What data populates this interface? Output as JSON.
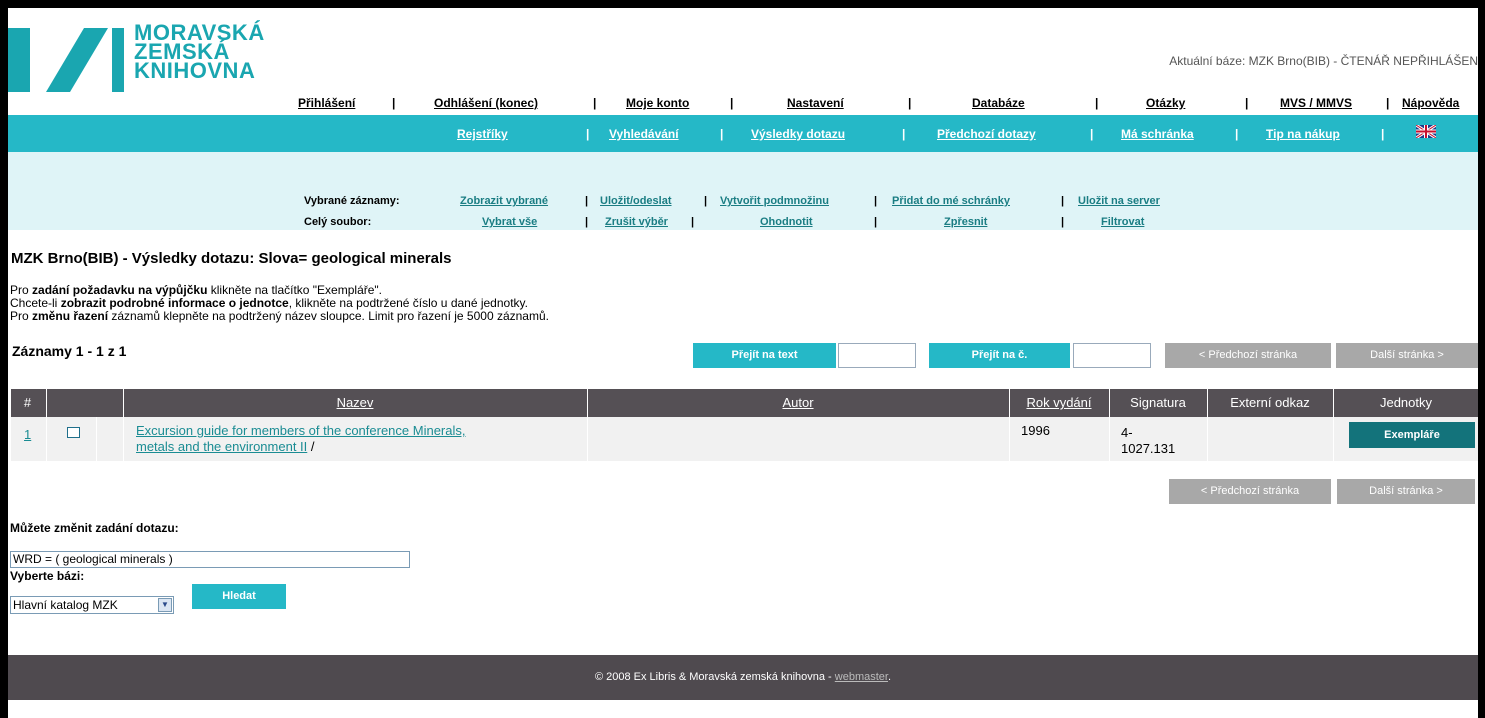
{
  "logo": {
    "lines": [
      "MORAVSKÁ",
      "ZEMSKÁ",
      "KNIHOVNA"
    ]
  },
  "header": {
    "current_base": "Aktuální báze: MZK Brno(BIB) - ČTENÁŘ NEPŘIHLÁŠEN"
  },
  "topnav": [
    "Přihlášení",
    "Odhlášení (konec)",
    "Moje konto",
    "Nastavení",
    "Databáze",
    "Otázky",
    "MVS / MMVS",
    "Nápověda"
  ],
  "mainnav": [
    "Rejstříky",
    "Vyhledávání",
    "Výsledky dotazu",
    "Předchozí dotazy",
    "Má schránka",
    "Tip na nákup"
  ],
  "selected": {
    "label": "Vybrané záznamy:",
    "actions": [
      "Zobrazit vybrané",
      "Uložit/odeslat",
      "Vytvořit podmnožinu",
      "Přidat do mé schránky",
      "Uložit na server"
    ]
  },
  "whole": {
    "label": "Celý soubor:",
    "actions": [
      "Vybrat vše",
      "Zrušit výběr",
      "Ohodnotit",
      "Zpřesnit",
      "Filtrovat"
    ]
  },
  "title": "MZK Brno(BIB) -  Výsledky dotazu:  Slova= geological minerals",
  "instructions": {
    "l1_pre": "Pro ",
    "l1_b": "zadání požadavku na výpůjčku",
    "l1_post": " klikněte na tlačítko \"Exempláře\".",
    "l2_pre": "Chcete-li ",
    "l2_b": "zobrazit podrobné informace o jednotce",
    "l2_post": ", klikněte na podtržené číslo u dané jednotky.",
    "l3_pre": "Pro ",
    "l3_b": "změnu řazení",
    "l3_post": " záznamů klepněte na podtržený název sloupce. Limit pro řazení je 5000 záznamů."
  },
  "records": "Záznamy 1 - 1 z 1",
  "nav_buttons": {
    "goto_text": "Přejít na text",
    "goto_no": "Přejít na č.",
    "prev": "< Předchozí stránka",
    "next": "Další stránka  >"
  },
  "table": {
    "headers": [
      "#",
      "",
      "Nazev",
      "Autor",
      "Rok vydání",
      "Signatura",
      "Externí odkaz",
      "Jednotky"
    ],
    "row": {
      "num": "1",
      "title_l1": "Excursion guide for members of the conference Minerals,",
      "title_l2": "metals and the environment II",
      "title_suffix": " /",
      "author": "",
      "year": "1996",
      "sig_l1": "4-",
      "sig_l2": "1027.131",
      "ext": "",
      "button": "Exempláře"
    }
  },
  "query": {
    "change_label": "Můžete změnit zadání dotazu:",
    "value": "WRD = ( geological minerals )",
    "base_label": "Vyberte bázi:",
    "base_selected": "Hlavní katalog MZK",
    "search_button": "Hledat"
  },
  "footer": {
    "text": "© 2008 Ex Libris & Moravská zemská knihovna - ",
    "link": "webmaster",
    "suffix": "."
  },
  "colors": {
    "teal": "#25b8c7",
    "dark_teal": "#13737b",
    "light_band": "#dff4f7",
    "table_header": "#555055",
    "footer": "#4f4a4f"
  }
}
